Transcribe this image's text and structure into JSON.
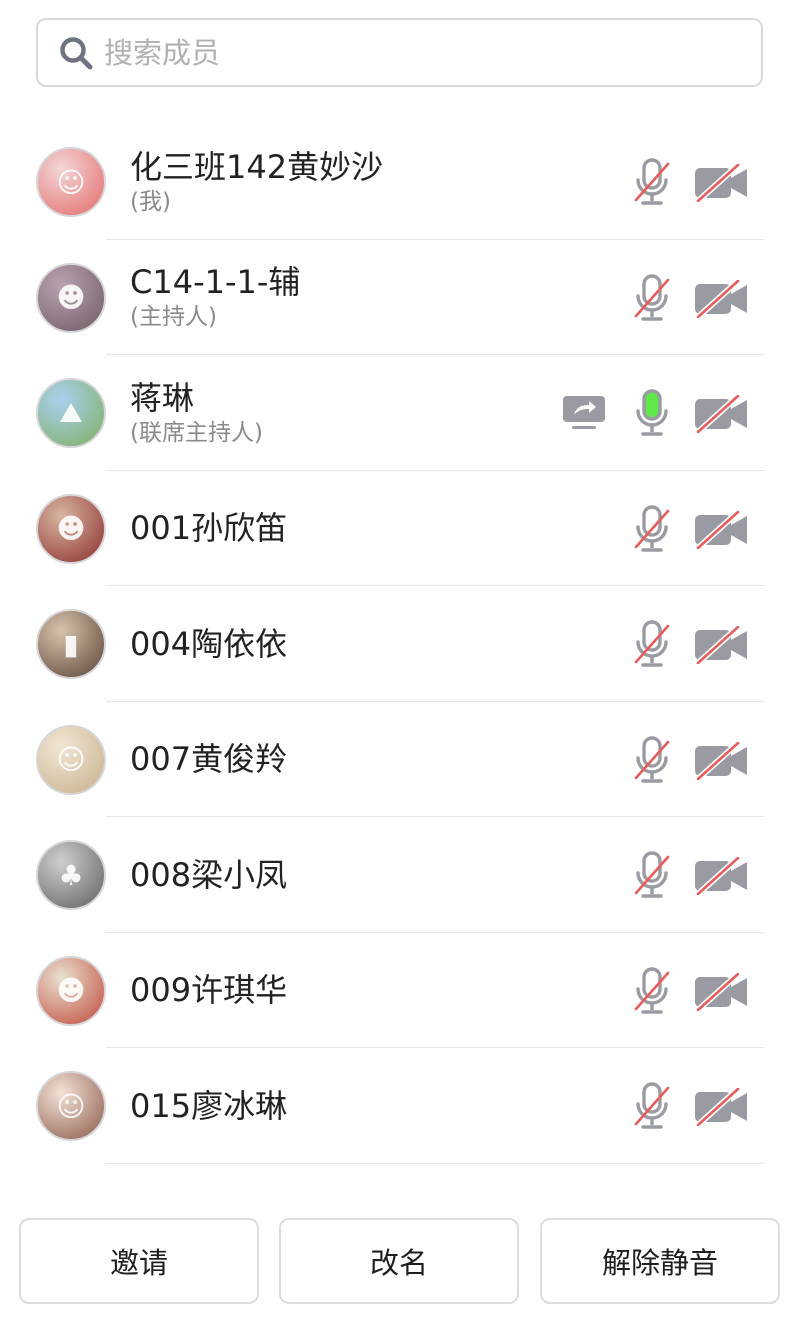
{
  "search": {
    "placeholder": "搜索成员",
    "value": ""
  },
  "members": [
    {
      "name": "化三班142黄妙沙",
      "role": "(我)",
      "avatar_colors": [
        "#f3d6d6",
        "#e46a6a"
      ],
      "avatar_glyph": "☺",
      "mic": "muted",
      "camera": "off",
      "sharing": false
    },
    {
      "name": "C14-1-1-辅",
      "role": "(主持人)",
      "avatar_colors": [
        "#b9a3b0",
        "#6f5a66"
      ],
      "avatar_glyph": "☻",
      "mic": "muted",
      "camera": "off",
      "sharing": false
    },
    {
      "name": "蒋琳",
      "role": "(联席主持人)",
      "avatar_colors": [
        "#a9d1f0",
        "#7fae5f"
      ],
      "avatar_glyph": "⛰",
      "mic": "active",
      "camera": "off",
      "sharing": true
    },
    {
      "name": "001孙欣笛",
      "role": "",
      "avatar_colors": [
        "#d8b6a0",
        "#8b2d2d"
      ],
      "avatar_glyph": "☻",
      "mic": "muted",
      "camera": "off",
      "sharing": false
    },
    {
      "name": "004陶依依",
      "role": "",
      "avatar_colors": [
        "#d8c4ad",
        "#5a4436"
      ],
      "avatar_glyph": "▮",
      "mic": "muted",
      "camera": "off",
      "sharing": false
    },
    {
      "name": "007黄俊羚",
      "role": "",
      "avatar_colors": [
        "#f0e6d6",
        "#c8b08a"
      ],
      "avatar_glyph": "☺",
      "mic": "muted",
      "camera": "off",
      "sharing": false
    },
    {
      "name": "008梁小凤",
      "role": "",
      "avatar_colors": [
        "#cfcfcf",
        "#5f5f5f"
      ],
      "avatar_glyph": "♣",
      "mic": "muted",
      "camera": "off",
      "sharing": false
    },
    {
      "name": "009许琪华",
      "role": "",
      "avatar_colors": [
        "#e9e1cf",
        "#c0483a"
      ],
      "avatar_glyph": "☻",
      "mic": "muted",
      "camera": "off",
      "sharing": false
    },
    {
      "name": "015廖冰琳",
      "role": "",
      "avatar_colors": [
        "#f4e1d6",
        "#8a5a4a"
      ],
      "avatar_glyph": "☺",
      "mic": "muted",
      "camera": "off",
      "sharing": false
    }
  ],
  "buttons": {
    "invite": "邀请",
    "rename": "改名",
    "unmute": "解除静音"
  },
  "colors": {
    "icon_gray": "#9a9aa2",
    "slash_red": "#e85c5c",
    "mic_active_green": "#5fe84a"
  }
}
